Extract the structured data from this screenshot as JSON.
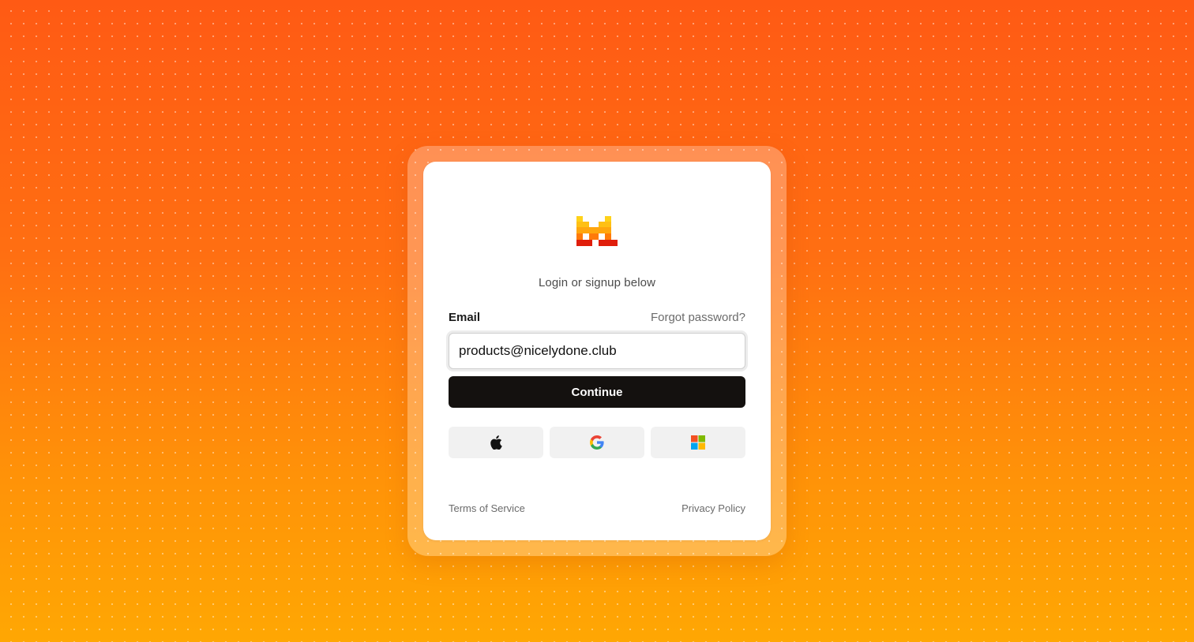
{
  "brand": {
    "logo_icon": "pixel-cat-logo-icon",
    "colors": {
      "yellow": "#ffd21a",
      "orange": "#ff8a0a",
      "red": "#e01e0b"
    }
  },
  "login": {
    "subtitle": "Login or signup below",
    "email_label": "Email",
    "forgot_password": "Forgot password?",
    "email_value": "products@nicelydone.club",
    "continue_label": "Continue"
  },
  "social": [
    {
      "icon": "apple-icon"
    },
    {
      "icon": "google-icon"
    },
    {
      "icon": "microsoft-icon"
    }
  ],
  "footer": {
    "terms": "Terms of Service",
    "privacy": "Privacy Policy"
  },
  "theme": {
    "background_top": "#ff5a14",
    "background_bottom": "#ffa703",
    "button_dark": "#14110f"
  }
}
